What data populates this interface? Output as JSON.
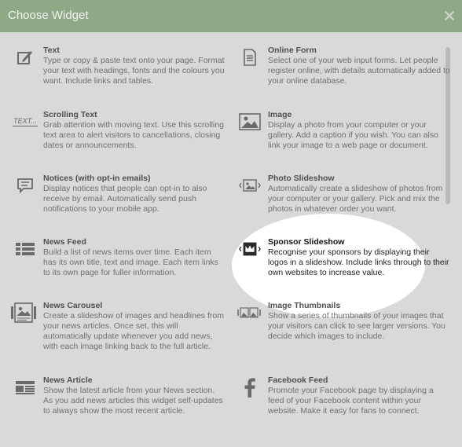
{
  "modal": {
    "title": "Choose Widget"
  },
  "widgets": [
    {
      "title": "Text",
      "description": "Type or copy & paste text onto your page. Format your text with headings, fonts and the colours you want. Include links and tables.",
      "icon": "edit-pencil-icon"
    },
    {
      "title": "Online Form",
      "description": "Select one of your web input forms. Let people register online, with details automatically added to your online database.",
      "icon": "document-icon"
    },
    {
      "title": "Scrolling Text",
      "description": "Grab attention with moving text. Use this scrolling text area to alert visitors to cancellations, closing dates or announcements.",
      "icon": "scrolling-text-icon",
      "icon_text": "TEXT..."
    },
    {
      "title": "Image",
      "description": "Display a photo from your computer or your gallery. Add a caption if you wish. You can also link your image to a web page or document.",
      "icon": "image-icon"
    },
    {
      "title": "Notices (with opt-in emails)",
      "description": "Display notices that people can opt-in to also receive by email. Automatically send push notifications to your mobile app.",
      "icon": "speech-bubble-icon"
    },
    {
      "title": "Photo Slideshow",
      "description": "Automatically create a slideshow of photos from your computer or your gallery. Pick and mix the photos in whatever order you want.",
      "icon": "photo-slideshow-icon"
    },
    {
      "title": "News Feed",
      "description": "Build a list of news items over time. Each item has its own title, text and image. Each item links to its own page for fuller information.",
      "icon": "news-feed-icon"
    },
    {
      "title": "Sponsor Slideshow",
      "description": "Recognise your sponsors by displaying their logos in a slideshow. Include links through to their own websites to increase value.",
      "icon": "crown-icon"
    },
    {
      "title": "News Carousel",
      "description": "Create a slideshow of images and headlines from your news articles. Once set, this will automatically update whenever you add news, with each image linking back to the full article.",
      "icon": "news-carousel-icon"
    },
    {
      "title": "Image Thumbnails",
      "description": "Show a series of thumbnails of your images that your visitors can click to see larger versions. You decide which images to include.",
      "icon": "image-thumbnails-icon"
    },
    {
      "title": "News Article",
      "description": "Show the latest article from your News section. As you add news articles this widget self-updates to always show the most recent article.",
      "icon": "news-article-icon"
    },
    {
      "title": "Facebook Feed",
      "description": "Promote your Facebook page by displaying a feed of your Facebook content within your website. Make it easy for fans to connect.",
      "icon": "facebook-icon"
    }
  ]
}
